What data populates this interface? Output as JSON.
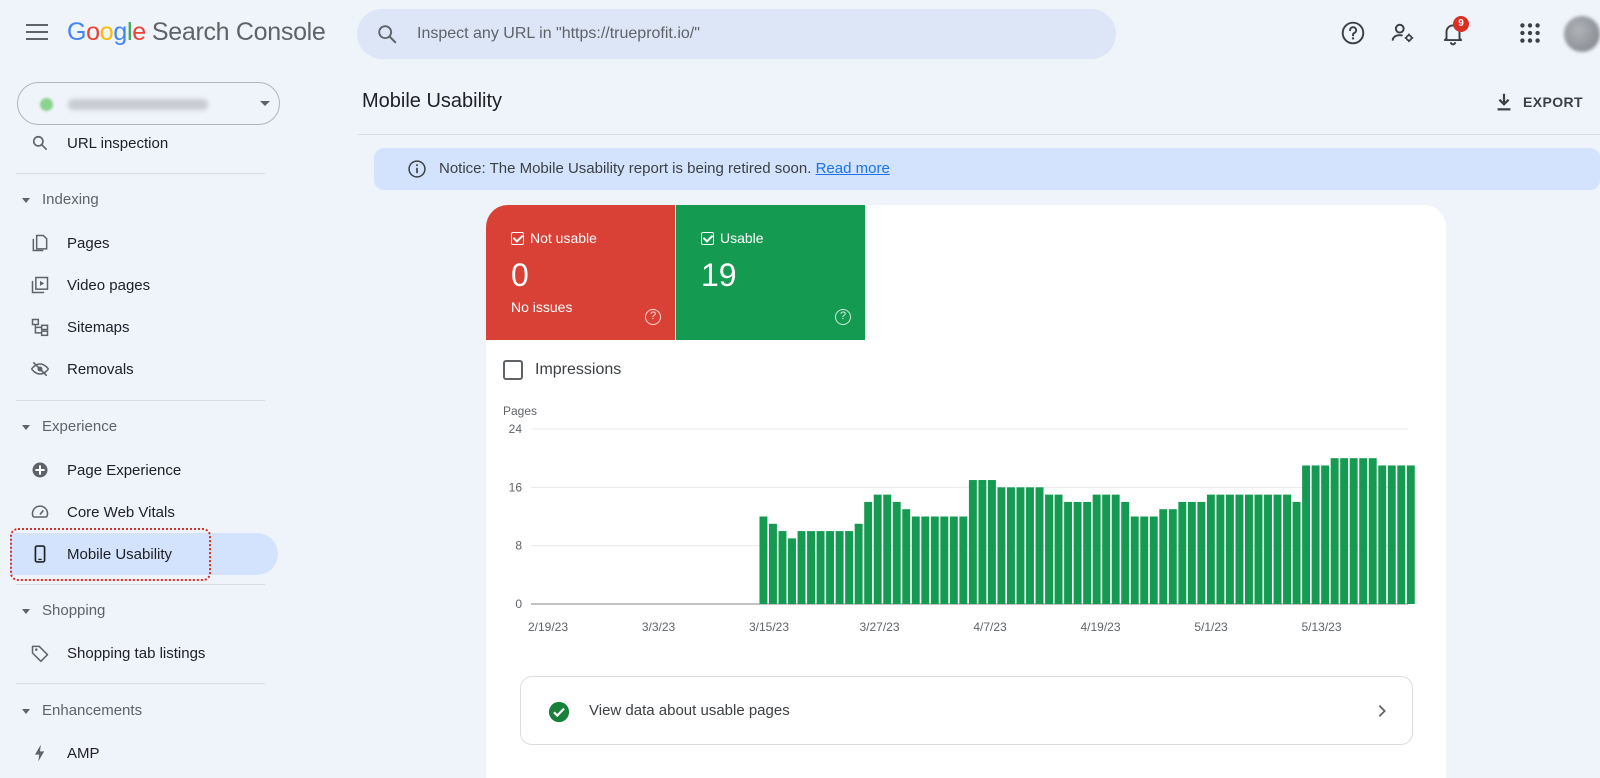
{
  "app": {
    "logo": {
      "g1": "G",
      "g2": "o",
      "g3": "o",
      "g4": "g",
      "g5": "l",
      "g6": "e",
      "product": "Search Console"
    },
    "search": {
      "placeholder": "Inspect any URL in \"https://trueprofit.io/\""
    },
    "topbar_icons": [
      "help-icon",
      "manage-users-icon",
      "notifications-icon",
      "apps-grid-icon"
    ],
    "notification_count": "9"
  },
  "sidebar": {
    "url_inspection": "URL inspection",
    "sections": {
      "indexing": "Indexing",
      "experience": "Experience",
      "shopping": "Shopping",
      "enhancements": "Enhancements"
    },
    "items": {
      "pages": "Pages",
      "video_pages": "Video pages",
      "sitemaps": "Sitemaps",
      "removals": "Removals",
      "page_experience": "Page Experience",
      "core_web_vitals": "Core Web Vitals",
      "mobile_usability": "Mobile Usability",
      "shopping_tab": "Shopping tab listings",
      "amp": "AMP"
    },
    "active_item": "mobile_usability"
  },
  "main": {
    "title": "Mobile Usability",
    "export_label": "EXPORT",
    "notice": {
      "text": "Notice: The Mobile Usability report is being retired soon.",
      "link": "Read more"
    },
    "tiles": {
      "not_usable": {
        "label": "Not usable",
        "value": "0",
        "sub": "No issues",
        "color": "#d94136"
      },
      "usable": {
        "label": "Usable",
        "value": "19",
        "color": "#159a51"
      }
    },
    "impressions_label": "Impressions",
    "view_data_label": "View data about usable pages"
  },
  "chart_data": {
    "type": "bar",
    "ylabel": "Pages",
    "ylim": [
      0,
      24
    ],
    "yticks": [
      0,
      8,
      16,
      24
    ],
    "xticks": [
      "2/19/23",
      "3/3/23",
      "3/15/23",
      "3/27/23",
      "4/7/23",
      "4/19/23",
      "5/1/23",
      "5/13/23"
    ],
    "grid": true,
    "bar_color": "#159a51",
    "series": [
      {
        "values": [
          0,
          0,
          0,
          0,
          0,
          0,
          0,
          0,
          0,
          0,
          0,
          0,
          0,
          0,
          0,
          0,
          0,
          0,
          0,
          0,
          0,
          0,
          0,
          0,
          12,
          11,
          10,
          9,
          10,
          10,
          10,
          10,
          10,
          10,
          11,
          14,
          15,
          15,
          14,
          13,
          12,
          12,
          12,
          12,
          12,
          12,
          17,
          17,
          17,
          16,
          16,
          16,
          16,
          16,
          15,
          15,
          14,
          14,
          14,
          15,
          15,
          15,
          14,
          12,
          12,
          12,
          13,
          13,
          14,
          14,
          14,
          15,
          15,
          15,
          15,
          15,
          15,
          15,
          15,
          15,
          14,
          19,
          19,
          19,
          20,
          20,
          20,
          20,
          20,
          19,
          19,
          19,
          19
        ]
      }
    ]
  }
}
